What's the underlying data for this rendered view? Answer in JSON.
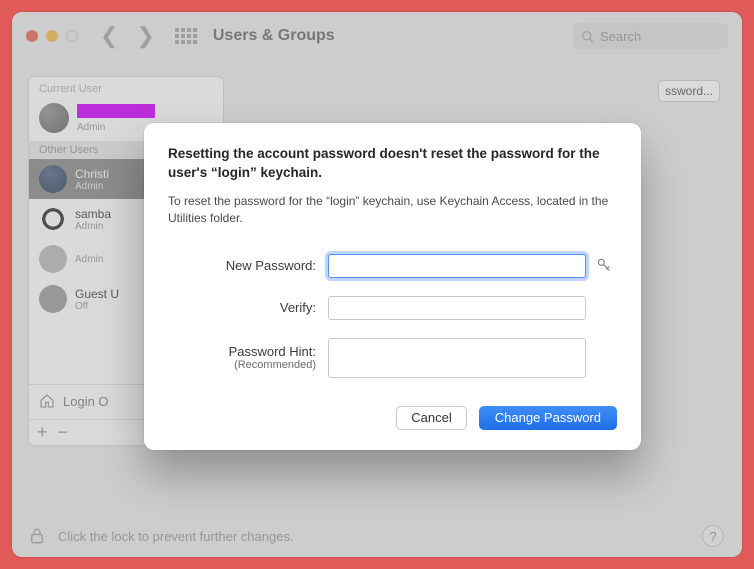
{
  "window": {
    "title": "Users & Groups"
  },
  "search": {
    "placeholder": "Search"
  },
  "sidebar": {
    "current_label": "Current User",
    "other_label": "Other Users",
    "current": {
      "sub": "Admin"
    },
    "users": [
      {
        "name": "Christi",
        "sub": "Admin"
      },
      {
        "name": "samba",
        "sub": "Admin"
      },
      {
        "name": "",
        "sub": "Admin"
      },
      {
        "name": "Guest U",
        "sub": "Off"
      }
    ],
    "login_options": "Login O",
    "plus": "+",
    "minus": "−"
  },
  "right": {
    "change_button": "ssword..."
  },
  "lock_row": {
    "text": "Click the lock to prevent further changes.",
    "help": "?"
  },
  "modal": {
    "title": "Resetting the account password doesn't reset the password for the user's “login” keychain.",
    "subtitle": "To reset the password for the “login” keychain, use Keychain Access, located in the Utilities folder.",
    "labels": {
      "new_password": "New Password:",
      "verify": "Verify:",
      "hint": "Password Hint:",
      "hint_rec": "(Recommended)"
    },
    "buttons": {
      "cancel": "Cancel",
      "change": "Change Password"
    }
  }
}
